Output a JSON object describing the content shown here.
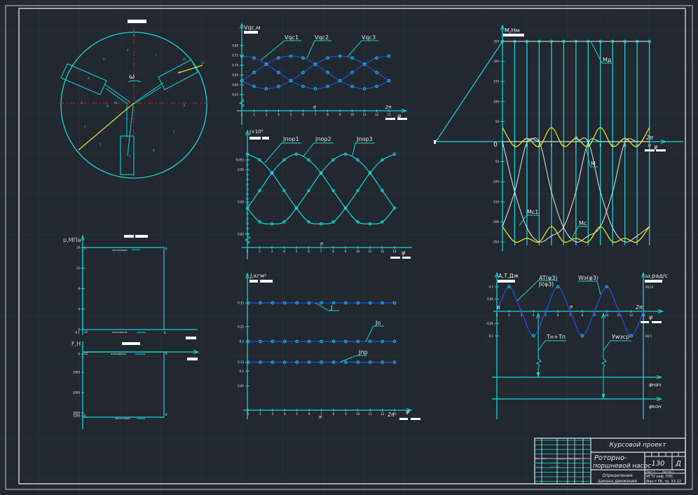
{
  "colors": {
    "background": "#212830",
    "grid": "#2c3440",
    "cyan": "#19d3d3",
    "blue": "#1f4fe0",
    "yellow": "#e8e020",
    "white": "#e8e8e8",
    "red": "#d01818"
  },
  "mechanism": {
    "omega": "ω",
    "points": [
      "A",
      "B",
      "C",
      "D"
    ],
    "positions": [
      "0",
      "1",
      "2",
      "3",
      "4",
      "5",
      "6",
      "7",
      "8",
      "9",
      "10",
      "11",
      "12"
    ]
  },
  "vqc_chart": {
    "title": "Vqc,м",
    "series_names": [
      "Vqc1",
      "Vqc2",
      "Vqc3"
    ],
    "y_ticks": [
      "0,80",
      "0,75",
      "0,70",
      "0,65",
      "0,60",
      "0,55"
    ],
    "y_tick_values": [
      0.8,
      0.75,
      0.7,
      0.65,
      0.6,
      0.55
    ],
    "x_ticks": [
      "1",
      "2",
      "3",
      "4",
      "5",
      "6",
      "7",
      "8",
      "9",
      "10",
      "11",
      "12",
      "13"
    ],
    "pi": "π",
    "two_pi": "2π",
    "phi": "φ",
    "base_shape": [
      0.746,
      0.737,
      0.705,
      0.663,
      0.621,
      0.592,
      0.58,
      0.592,
      0.621,
      0.663,
      0.705,
      0.737
    ],
    "phase_shifts": [
      0,
      8,
      4
    ]
  },
  "jpor_chart": {
    "title": "J×10⁵",
    "series_names": [
      "Jпор1",
      "Jпор2",
      "Jпор3"
    ],
    "y_ticks": [
      "0,053",
      "0,05",
      "0,04",
      "0,03"
    ],
    "y_tick_values": [
      0.053,
      0.05,
      0.04,
      0.03
    ],
    "x_ticks": [
      "1",
      "2",
      "3",
      "4",
      "5",
      "6",
      "7",
      "8",
      "9",
      "10",
      "11",
      "12",
      "13"
    ],
    "pi": "π",
    "phi": "φ",
    "base_shape": [
      0.0548,
      0.053,
      0.049,
      0.0435,
      0.0381,
      0.0338,
      0.0332,
      0.0338,
      0.0381,
      0.0435,
      0.049,
      0.053
    ],
    "phase_shifts": [
      0,
      8,
      4
    ]
  },
  "j_chart": {
    "title": "J,кгм²",
    "y_ticks": [
      "0,33",
      "0,25",
      "0,2",
      "0,13",
      "0,1",
      "0,05"
    ],
    "y_tick_values": [
      0.33,
      0.25,
      0.2,
      0.13,
      0.1,
      0.05
    ],
    "x_ticks": [
      "1",
      "2",
      "3",
      "4",
      "5",
      "6",
      "7",
      "8",
      "9",
      "10",
      "11",
      "12",
      "13"
    ],
    "pi": "π",
    "two_pi": "2π",
    "phi": "φ",
    "series": [
      {
        "name": "J",
        "value": 0.33
      },
      {
        "name": "Jo",
        "value": 0.2
      },
      {
        "name": "Jпр",
        "value": 0.13
      }
    ]
  },
  "m_chart": {
    "title": "M,Нм",
    "origin_label": "0",
    "y_ticks": [
      "250",
      "200",
      "150",
      "100",
      "50",
      "-50",
      "-100",
      "-150",
      "-200",
      "-250"
    ],
    "y_tick_values": [
      250,
      200,
      150,
      100,
      50,
      -50,
      -100,
      -150,
      -200,
      -250
    ],
    "x_ticks": [
      "1",
      "2",
      "3",
      "4",
      "5",
      "6",
      "7",
      "8",
      "9",
      "10",
      "11",
      "12",
      "13"
    ],
    "pi": "π",
    "two_pi": "2π",
    "phi": "φ",
    "labels": {
      "md": "Mд",
      "m": "M",
      "mc1": "Mc1",
      "mc": "Mc"
    },
    "md_value": 250,
    "m_total": [
      35,
      -12,
      8,
      -12,
      35,
      -12,
      8,
      -12,
      35,
      -12,
      8,
      -12,
      35
    ],
    "mc_total": [
      -212,
      -250,
      -241,
      -250,
      -212,
      -250,
      -241,
      -250,
      -212,
      -250,
      -241,
      -250,
      -212
    ],
    "mc_cylinder_shape": [
      0,
      -125,
      -215,
      -250,
      -235,
      -212,
      -125,
      -2,
      0,
      0,
      0,
      0
    ],
    "mc_phase_shifts": [
      0,
      5,
      9
    ]
  },
  "at_chart": {
    "title": "A,T,Дж",
    "right_title": "ω,рад/с",
    "y_ticks": [
      "0,1",
      "0,05",
      "-0,05",
      "-0,1"
    ],
    "y_tick_values": [
      0.1,
      0.05,
      -0.05,
      -0.1
    ],
    "right_ticks": [
      "60,53",
      "60,5"
    ],
    "x_ticks": [
      "1",
      "2",
      "3",
      "4",
      "5",
      "6",
      "7",
      "8",
      "9",
      "10",
      "11",
      "12",
      "13"
    ],
    "pi": "π",
    "two_pi": "2π",
    "phi": "φ",
    "labels": {
      "at": "AT(φ3)",
      "ji": "Ji(φ3)",
      "w": "Wэ(φ3)",
      "tn": "Тн+Тп",
      "wcp": "Уwзср"
    },
    "values": [
      0,
      0.1,
      0,
      -0.1,
      0,
      0.1,
      0,
      -0.1,
      0,
      0.1,
      0,
      -0.1,
      0
    ],
    "phi_labels": [
      "φнач",
      "φкон"
    ]
  },
  "p_chart": {
    "title": "р,МПа",
    "y_ticks": [
      "16",
      "12",
      "8",
      "4",
      "0",
      "-0,1"
    ],
    "y_tick_values": [
      16,
      12,
      8,
      4,
      0,
      -0.1
    ],
    "top_note": "нагнетание",
    "bottom_note": "всасывание",
    "corner_labels": [
      "1",
      "6",
      "12",
      "6"
    ]
  },
  "f_chart": {
    "title": "F,Н",
    "y_ticks": [
      "0",
      "1000",
      "2000",
      "3000",
      "3200"
    ],
    "top_note": "всасывание",
    "bottom_note": "нагнетание",
    "corner_labels": [
      "12",
      "6",
      "1",
      "6"
    ]
  },
  "title_block": {
    "project": "Курсовой проект",
    "name_line1": "Роторно-",
    "name_line2": "поршневой насос",
    "number": "130",
    "letter": "Д",
    "subject_line1": "Определение",
    "subject_line2": "закона движения",
    "sheet": "Лист 1",
    "sheets": "Листов 1",
    "org_line1": "ИГТУ каф. НЭС",
    "org_line2": "Фак-т РК, гр. 33-12",
    "roles": [
      "Изм",
      "Лист",
      "№ докум.",
      "Подп.",
      "Дата"
    ],
    "people": [
      [
        "Разраб.",
        "Студент"
      ],
      [
        "Пров.",
        "Сергеев"
      ]
    ]
  }
}
